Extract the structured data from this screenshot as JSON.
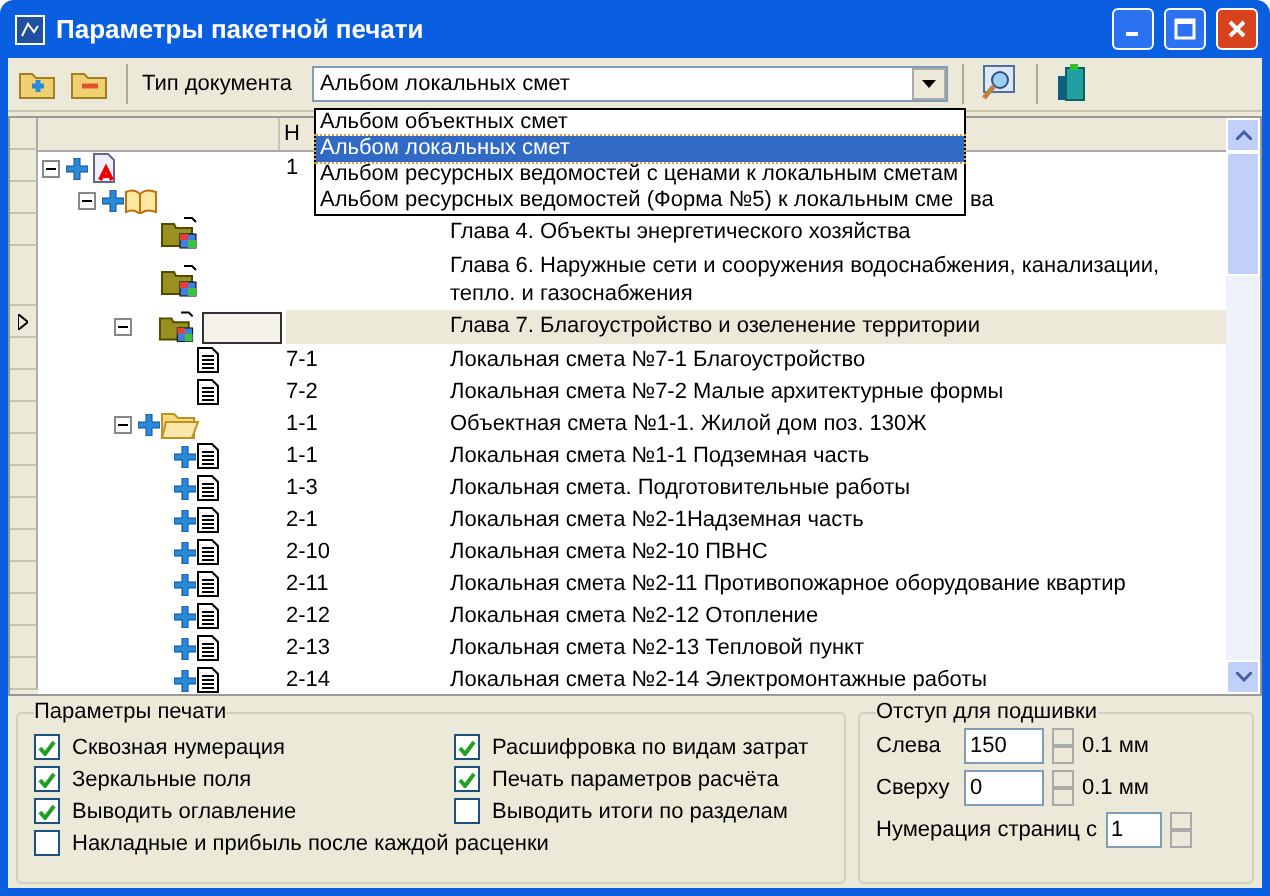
{
  "window": {
    "title": "Параметры пакетной печати"
  },
  "toolbar": {
    "doc_type_label": "Тип документа",
    "doc_type_value": "Альбом локальных смет",
    "dropdown": [
      {
        "label": "Альбом объектных смет",
        "selected": false
      },
      {
        "label": "Альбом локальных смет",
        "selected": true
      },
      {
        "label": "Альбом ресурсных ведомостей с ценами к локальным сметам",
        "selected": false
      },
      {
        "label": "Альбом ресурсных ведомостей (Форма №5) к локальным сме",
        "selected": false
      }
    ]
  },
  "grid": {
    "columns": [
      "Н"
    ],
    "tree": [
      {
        "number": "1",
        "kind": "estimate",
        "expanded": true,
        "flag": true,
        "selected": false,
        "children": [
          {
            "name": "ва",
            "covered": true,
            "kind": "book",
            "expanded": true,
            "flag": true,
            "selected": false,
            "children": [
              {
                "name": "Глава 4. Объекты энергетического хозяйства",
                "kind": "chapter",
                "flag": false,
                "selected": false
              },
              {
                "name": "Глава 6. Наружные сети и сооружения водоснабжения, канализации, тепло. и газоснабжения",
                "kind": "chapter",
                "flag": false,
                "selected": false
              },
              {
                "name": "Глава 7. Благоустройство и озеленение территории",
                "kind": "chapter",
                "expanded": true,
                "flag": false,
                "selected": true,
                "children": [
                  {
                    "number": "7-1",
                    "name": "Локальная смета №7-1   Благоустройство",
                    "kind": "doc",
                    "flag": false,
                    "selected": false
                  },
                  {
                    "number": "7-2",
                    "name": "Локальная смета №7-2  Малые архитектурные формы",
                    "kind": "doc",
                    "flag": false,
                    "selected": false
                  }
                ]
              },
              {
                "number": "1-1",
                "name": "Объектная смета №1-1. Жилой дом поз. 130Ж",
                "kind": "folder",
                "expanded": true,
                "flag": true,
                "selected": false,
                "children": [
                  {
                    "number": "1-1",
                    "name": "Локальная смета №1-1 Подземная часть",
                    "kind": "doc",
                    "flag": true,
                    "selected": false
                  },
                  {
                    "number": "1-3",
                    "name": "Локальная смета. Подготовительные работы",
                    "kind": "doc",
                    "flag": true,
                    "selected": false
                  },
                  {
                    "number": "2-1",
                    "name": "Локальная смета №2-1Надземная часть",
                    "kind": "doc",
                    "flag": true,
                    "selected": false
                  },
                  {
                    "number": "2-10",
                    "name": "Локальная смета №2-10 ПВНС",
                    "kind": "doc",
                    "flag": true,
                    "selected": false
                  },
                  {
                    "number": "2-11",
                    "name": "Локальная смета №2-11 Противопожарное оборудование квартир",
                    "kind": "doc",
                    "flag": true,
                    "selected": false
                  },
                  {
                    "number": "2-12",
                    "name": "Локальная смета №2-12 Отопление",
                    "kind": "doc",
                    "flag": true,
                    "selected": false
                  },
                  {
                    "number": "2-13",
                    "name": "Локальная смета №2-13 Тепловой пункт",
                    "kind": "doc",
                    "flag": true,
                    "selected": false
                  },
                  {
                    "number": "2-14",
                    "name": "Локальная смета №2-14 Электромонтажные работы",
                    "kind": "doc",
                    "flag": true,
                    "selected": false
                  }
                ]
              }
            ]
          }
        ]
      }
    ]
  },
  "print_params": {
    "title": "Параметры печати",
    "options": [
      {
        "label": "Сквозная нумерация",
        "checked": true
      },
      {
        "label": "Расшифровка по видам затрат",
        "checked": true
      },
      {
        "label": "Зеркальные поля",
        "checked": true
      },
      {
        "label": "Печать параметров расчёта",
        "checked": true
      },
      {
        "label": "Выводить оглавление",
        "checked": true
      },
      {
        "label": "Выводить итоги по разделам",
        "checked": false
      },
      {
        "label": "Накладные и прибыль после каждой расценки",
        "checked": false
      }
    ]
  },
  "binding": {
    "title": "Отступ для подшивки",
    "fields": [
      {
        "label": "Слева",
        "value": "150",
        "unit": "0.1 мм"
      },
      {
        "label": "Сверху",
        "value": "0",
        "unit": "0.1 мм"
      },
      {
        "label": "Нумерация страниц с",
        "value": "1"
      }
    ]
  }
}
